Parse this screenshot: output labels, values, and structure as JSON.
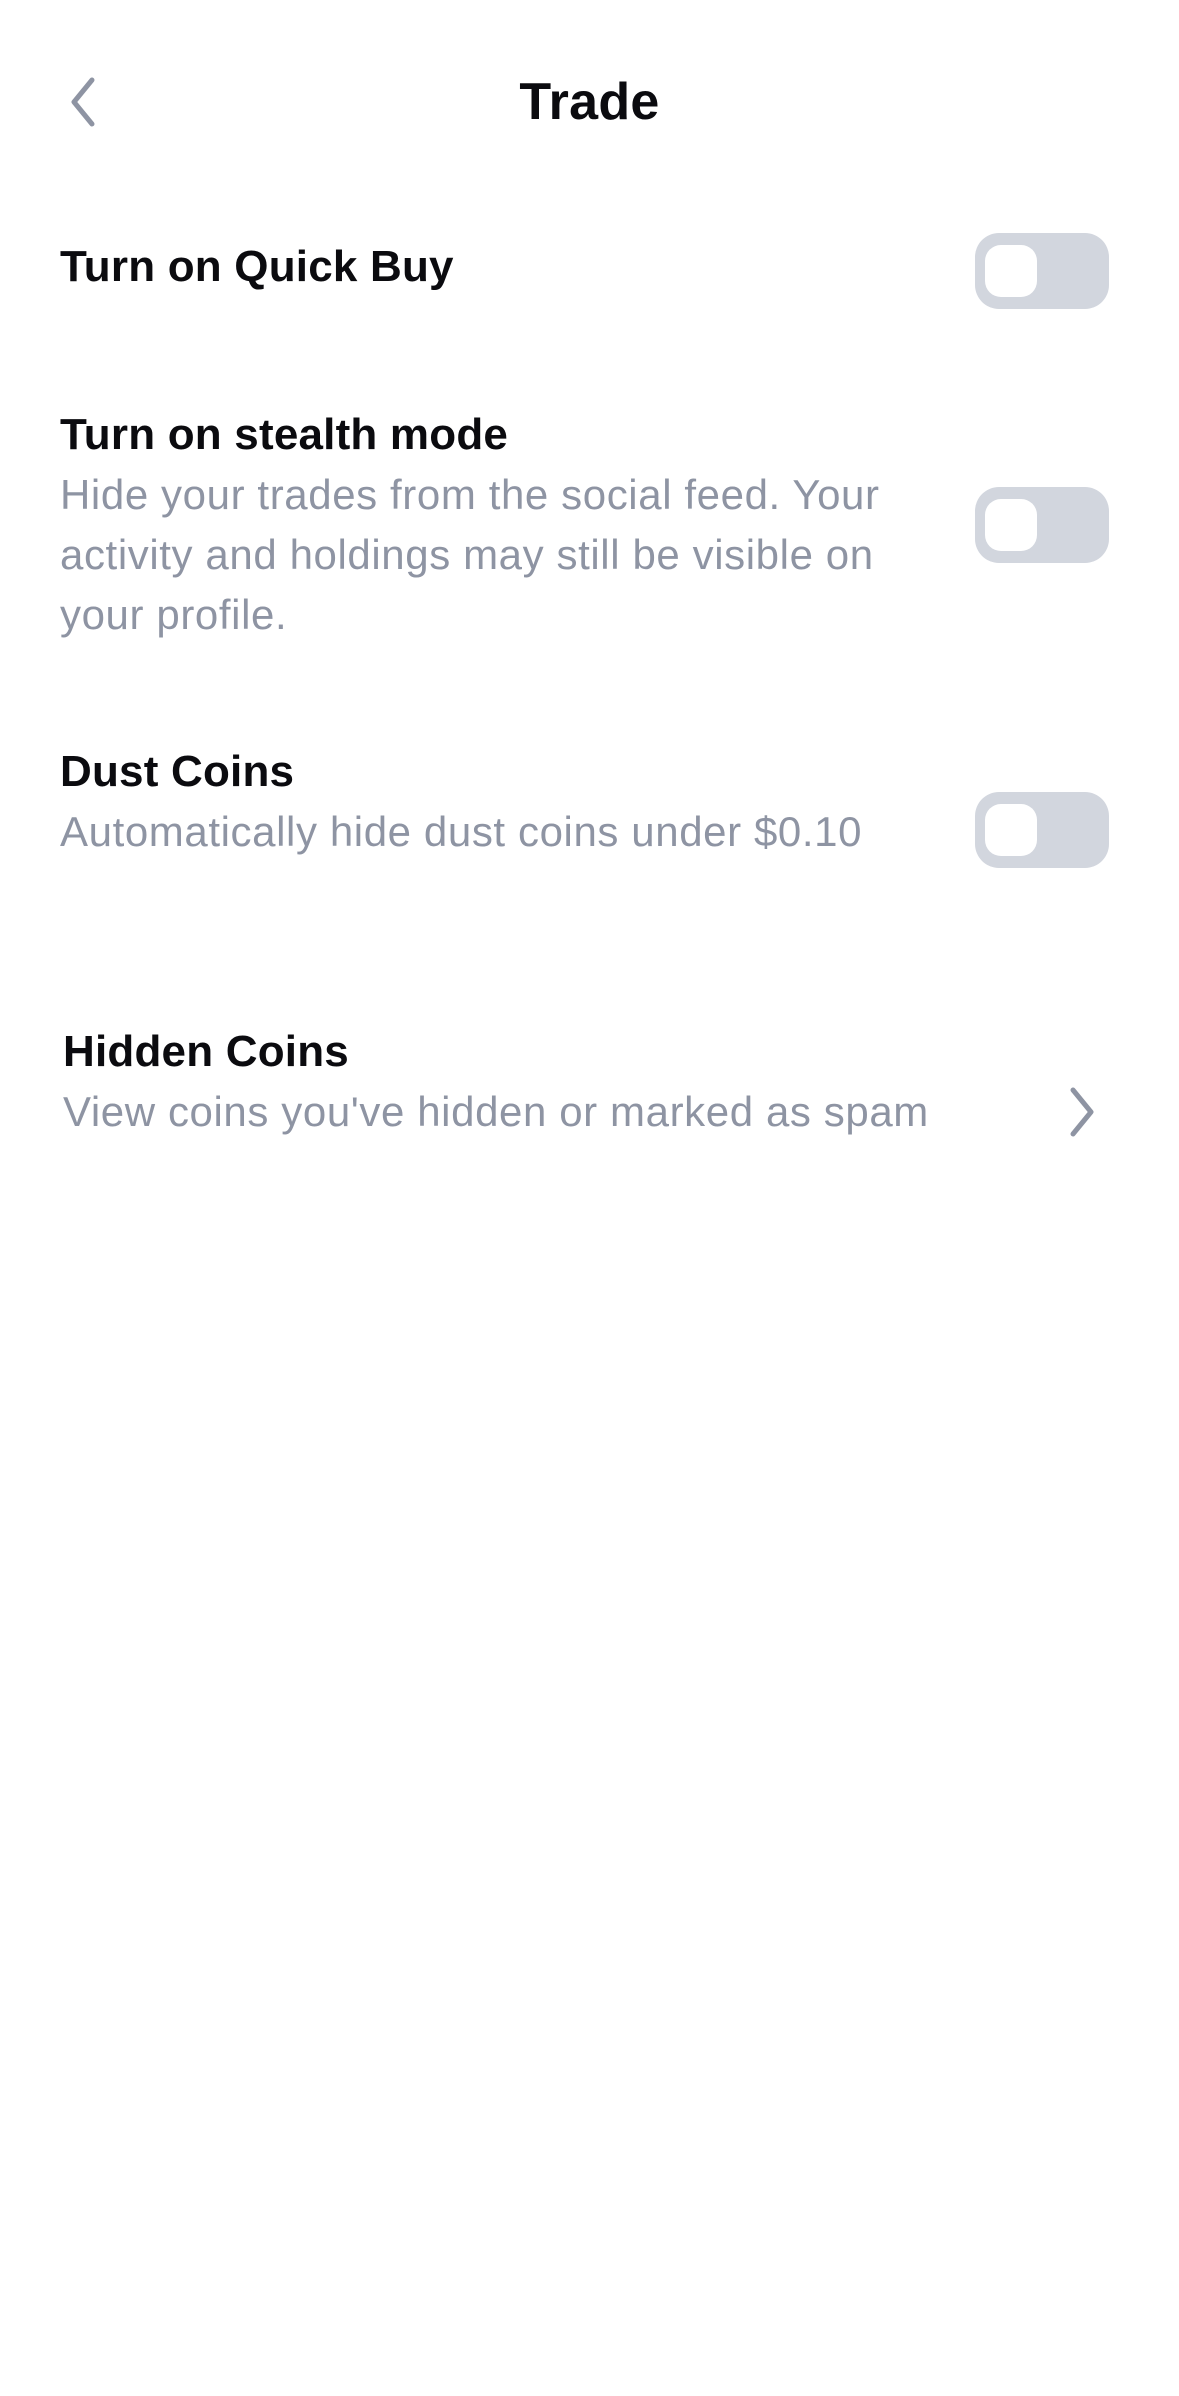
{
  "header": {
    "title": "Trade",
    "back_icon": "chevron-left-icon"
  },
  "settings": {
    "quick_buy": {
      "title": "Turn on Quick Buy",
      "enabled": false
    },
    "stealth_mode": {
      "title": "Turn on stealth mode",
      "description": "Hide your trades from the social feed. Your activity and holdings may still be visible on your profile.",
      "enabled": false
    },
    "dust_coins": {
      "title": "Dust Coins",
      "description": "Automatically hide dust coins under $0.10",
      "enabled": false
    },
    "hidden_coins": {
      "title": "Hidden Coins",
      "description": "View coins you've hidden or marked as spam",
      "icon": "chevron-right-icon"
    }
  },
  "colors": {
    "title_text": "#0b0b0f",
    "secondary_text": "#8e94a3",
    "toggle_off_track": "#d2d6de",
    "toggle_knob": "#ffffff",
    "icon_gray": "#8e94a3",
    "background": "#ffffff"
  }
}
